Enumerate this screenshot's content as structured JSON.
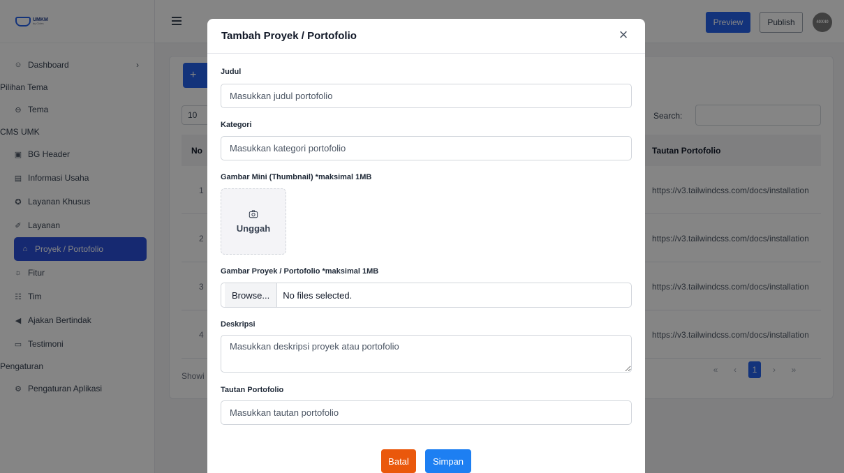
{
  "logo": {
    "brand": "UMKM",
    "sub": "by Cides"
  },
  "sidebar": {
    "items": [
      {
        "type": "item",
        "icon": "smile-icon",
        "glyph": "☺",
        "label": "Dashboard",
        "chevron": "›"
      },
      {
        "type": "section",
        "label": "Pilihan Tema"
      },
      {
        "type": "item",
        "icon": "palette-icon",
        "glyph": "⊖",
        "label": "Tema"
      },
      {
        "type": "section",
        "label": "CMS UMK"
      },
      {
        "type": "item",
        "icon": "image-icon",
        "glyph": "▣",
        "label": "BG Header"
      },
      {
        "type": "item",
        "icon": "info-icon",
        "glyph": "▤",
        "label": "Informasi Usaha"
      },
      {
        "type": "item",
        "icon": "star-icon",
        "glyph": "✪",
        "label": "Layanan Khusus"
      },
      {
        "type": "item",
        "icon": "tools-icon",
        "glyph": "✐",
        "label": "Layanan"
      },
      {
        "type": "item",
        "icon": "briefcase-icon",
        "glyph": "⌂",
        "label": "Proyek / Portofolio",
        "active": true
      },
      {
        "type": "item",
        "icon": "bulb-icon",
        "glyph": "☼",
        "label": "Fitur"
      },
      {
        "type": "item",
        "icon": "team-icon",
        "glyph": "☷",
        "label": "Tim"
      },
      {
        "type": "item",
        "icon": "megaphone-icon",
        "glyph": "◀",
        "label": "Ajakan Bertindak"
      },
      {
        "type": "item",
        "icon": "message-icon",
        "glyph": "▭",
        "label": "Testimoni"
      },
      {
        "type": "section",
        "label": "Pengaturan"
      },
      {
        "type": "item",
        "icon": "gear-icon",
        "glyph": "⚙",
        "label": "Pengaturan Aplikasi"
      }
    ]
  },
  "topbar": {
    "preview_label": "Preview",
    "publish_label": "Publish",
    "avatar_text": "40X40"
  },
  "table": {
    "add_label": "+",
    "per_page": "10",
    "search_label": "Search:",
    "col_no": "No",
    "col_link": "Tautan Portofolio",
    "rows": [
      {
        "no": "1",
        "link": "https://v3.tailwindcss.com/docs/installation"
      },
      {
        "no": "2",
        "link": "https://v3.tailwindcss.com/docs/installation"
      },
      {
        "no": "3",
        "link": "https://v3.tailwindcss.com/docs/installation"
      },
      {
        "no": "4",
        "link": "https://v3.tailwindcss.com/docs/installation"
      }
    ],
    "showing": "Showi",
    "pager": {
      "first": "«",
      "prev": "‹",
      "current": "1",
      "next": "›",
      "last": "»"
    }
  },
  "modal": {
    "title": "Tambah Proyek / Portofolio",
    "close": "×",
    "judul_label": "Judul",
    "judul_placeholder": "Masukkan judul portofolio",
    "kategori_label": "Kategori",
    "kategori_placeholder": "Masukkan kategori portofolio",
    "thumb_label": "Gambar Mini (Thumbnail) *maksimal 1MB",
    "upload_label": "Unggah",
    "image_label": "Gambar Proyek / Portofolio *maksimal 1MB",
    "browse_label": "Browse...",
    "no_file": "No files selected.",
    "desc_label": "Deskripsi",
    "desc_placeholder": "Masukkan deskripsi proyek atau portofolio",
    "link_label": "Tautan Portofolio",
    "link_placeholder": "Masukkan tautan portofolio",
    "cancel_label": "Batal",
    "save_label": "Simpan"
  },
  "colors": {
    "primary": "#2563eb",
    "active_nav": "#2b4fd8",
    "cancel": "#ea580c",
    "save": "#1d7ff2"
  }
}
